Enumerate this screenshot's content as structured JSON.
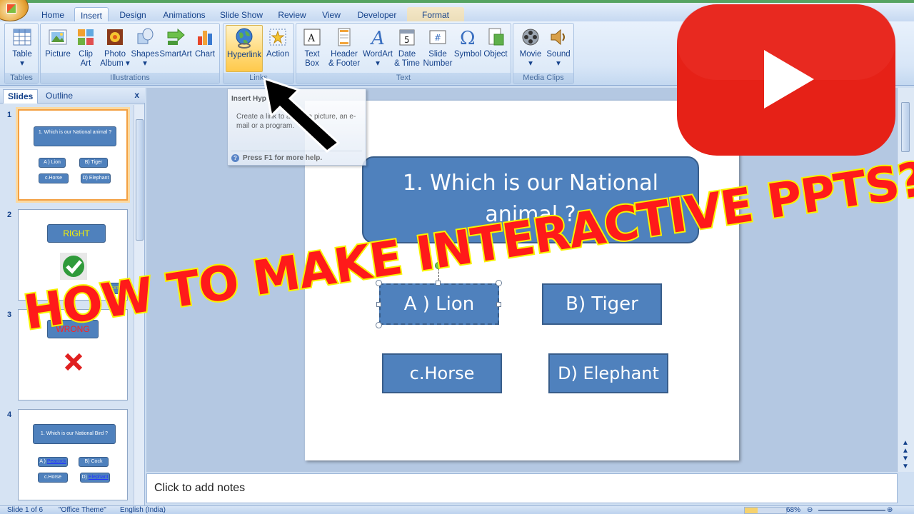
{
  "tabs": [
    {
      "label": "Home"
    },
    {
      "label": "Insert"
    },
    {
      "label": "Design"
    },
    {
      "label": "Animations"
    },
    {
      "label": "Slide Show"
    },
    {
      "label": "Review"
    },
    {
      "label": "View"
    },
    {
      "label": "Developer"
    },
    {
      "label": "Format"
    }
  ],
  "active_tab": "Insert",
  "ribbon": {
    "tables": {
      "label": "Tables",
      "table": "Table"
    },
    "illustrations": {
      "label": "Illustrations",
      "picture": "Picture",
      "clip_art_1": "Clip",
      "clip_art_2": "Art",
      "photo_album_1": "Photo",
      "photo_album_2": "Album ▾",
      "shapes": "Shapes",
      "smartart": "SmartArt",
      "chart": "Chart"
    },
    "links": {
      "label": "Links",
      "hyperlink": "Hyperlink",
      "action": "Action"
    },
    "text": {
      "label": "Text",
      "text_box_1": "Text",
      "text_box_2": "Box",
      "header_footer_1": "Header",
      "header_footer_2": "& Footer",
      "wordart": "WordArt",
      "date_time_1": "Date",
      "date_time_2": "& Time",
      "slide_number_1": "Slide",
      "slide_number_2": "Number",
      "symbol": "Symbol",
      "object": "Object"
    },
    "media_clips": {
      "label": "Media Clips",
      "movie": "Movie",
      "sound": "Sound"
    }
  },
  "tooltip": {
    "title": "Insert Hyp        + K)",
    "description": "Create a link to a     age, a picture, an e-mail        or a program.",
    "help": "Press F1 for more help."
  },
  "left_panel": {
    "tab_slides": "Slides",
    "tab_outline": "Outline",
    "close": "x",
    "thumbnails": [
      {
        "num": "1",
        "question": "1. Which is our National animal ?",
        "options": [
          "A ) Lion",
          "B) Tiger",
          "c.Horse",
          "D) Elephant"
        ]
      },
      {
        "num": "2",
        "label": "RIGHT",
        "next": "NEXT"
      },
      {
        "num": "3",
        "label": "WRONG"
      },
      {
        "num": "4",
        "question": "1. Which is our National Bird ?",
        "options_prefix": [
          "A )",
          "B) Cock",
          "c.Horse",
          "D)"
        ],
        "options_links": [
          "Peacock",
          "Elephant"
        ]
      }
    ]
  },
  "slide": {
    "question": "1. Which is our National animal ?",
    "option_a": "A ) Lion",
    "option_b": "B) Tiger",
    "option_c": "c.Horse",
    "option_d": "D) Elephant"
  },
  "notes_placeholder": "Click to add notes",
  "status": {
    "slide_count": "Slide 1 of 6",
    "theme": "\"Office Theme\"",
    "language": "English (India)",
    "zoom": "68%"
  },
  "overlay": {
    "headline": "HOW TO MAKE INTERACTIVE PPTS???"
  },
  "colors": {
    "shape_fill": "#4f81bd",
    "shape_border": "#385d8a",
    "headline_fill": "#ff1a1a",
    "headline_stroke": "#f8f200",
    "youtube_red": "#e62117"
  }
}
